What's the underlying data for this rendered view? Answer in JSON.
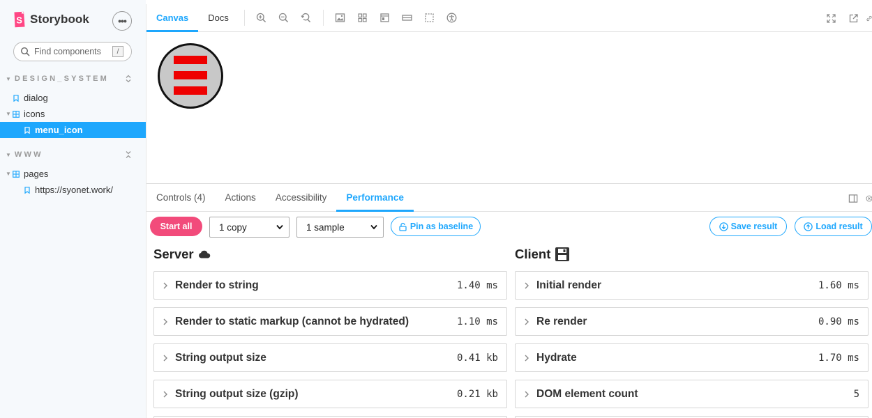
{
  "sidebar": {
    "brand": "Storybook",
    "search": {
      "placeholder": "Find components",
      "shortcut": "/"
    },
    "groups": [
      {
        "title": "DESIGN_SYSTEM"
      },
      {
        "title": "WWW"
      }
    ],
    "items": [
      {
        "label": "dialog"
      },
      {
        "label": "icons"
      },
      {
        "label": "menu_icon"
      },
      {
        "label": "pages"
      },
      {
        "label": "https://syonet.work/"
      }
    ]
  },
  "toolbar": {
    "tabs": [
      {
        "label": "Canvas"
      },
      {
        "label": "Docs"
      }
    ],
    "icons": [
      "zoom-in-icon",
      "zoom-out-icon",
      "zoom-reset-icon",
      "background-icon",
      "grid-icon",
      "viewport-icon",
      "measure-icon",
      "outline-icon",
      "accessibility-icon"
    ],
    "right_icons": [
      "fullscreen-icon",
      "open-new-tab-icon",
      "copy-link-icon"
    ]
  },
  "preview": {
    "icon": "menu-icon"
  },
  "addons": {
    "tabs": [
      {
        "label": "Controls (4)"
      },
      {
        "label": "Actions"
      },
      {
        "label": "Accessibility"
      },
      {
        "label": "Performance"
      }
    ],
    "active_tab": "Performance"
  },
  "performance": {
    "start_label": "Start all",
    "copies": "1 copy",
    "samples": "1 sample",
    "pin_label": "Pin as baseline",
    "save_label": "Save result",
    "load_label": "Load result",
    "server": {
      "title": "Server",
      "metrics": [
        {
          "label": "Render to string",
          "value": "1.40 ms"
        },
        {
          "label": "Render to static markup (cannot be hydrated)",
          "value": "1.10 ms"
        },
        {
          "label": "String output size",
          "value": "0.41 kb"
        },
        {
          "label": "String output size (gzip)",
          "value": "0.21 kb"
        }
      ]
    },
    "client": {
      "title": "Client",
      "metrics": [
        {
          "label": "Initial render",
          "value": "1.60 ms"
        },
        {
          "label": "Re render",
          "value": "0.90 ms"
        },
        {
          "label": "Hydrate",
          "value": "1.70 ms"
        },
        {
          "label": "DOM element count",
          "value": "5"
        }
      ]
    }
  },
  "colors": {
    "accent": "#1ea7fd",
    "brand": "#ff4785",
    "start_button": "#f24b7b",
    "menu_bars": "#ee0000"
  }
}
